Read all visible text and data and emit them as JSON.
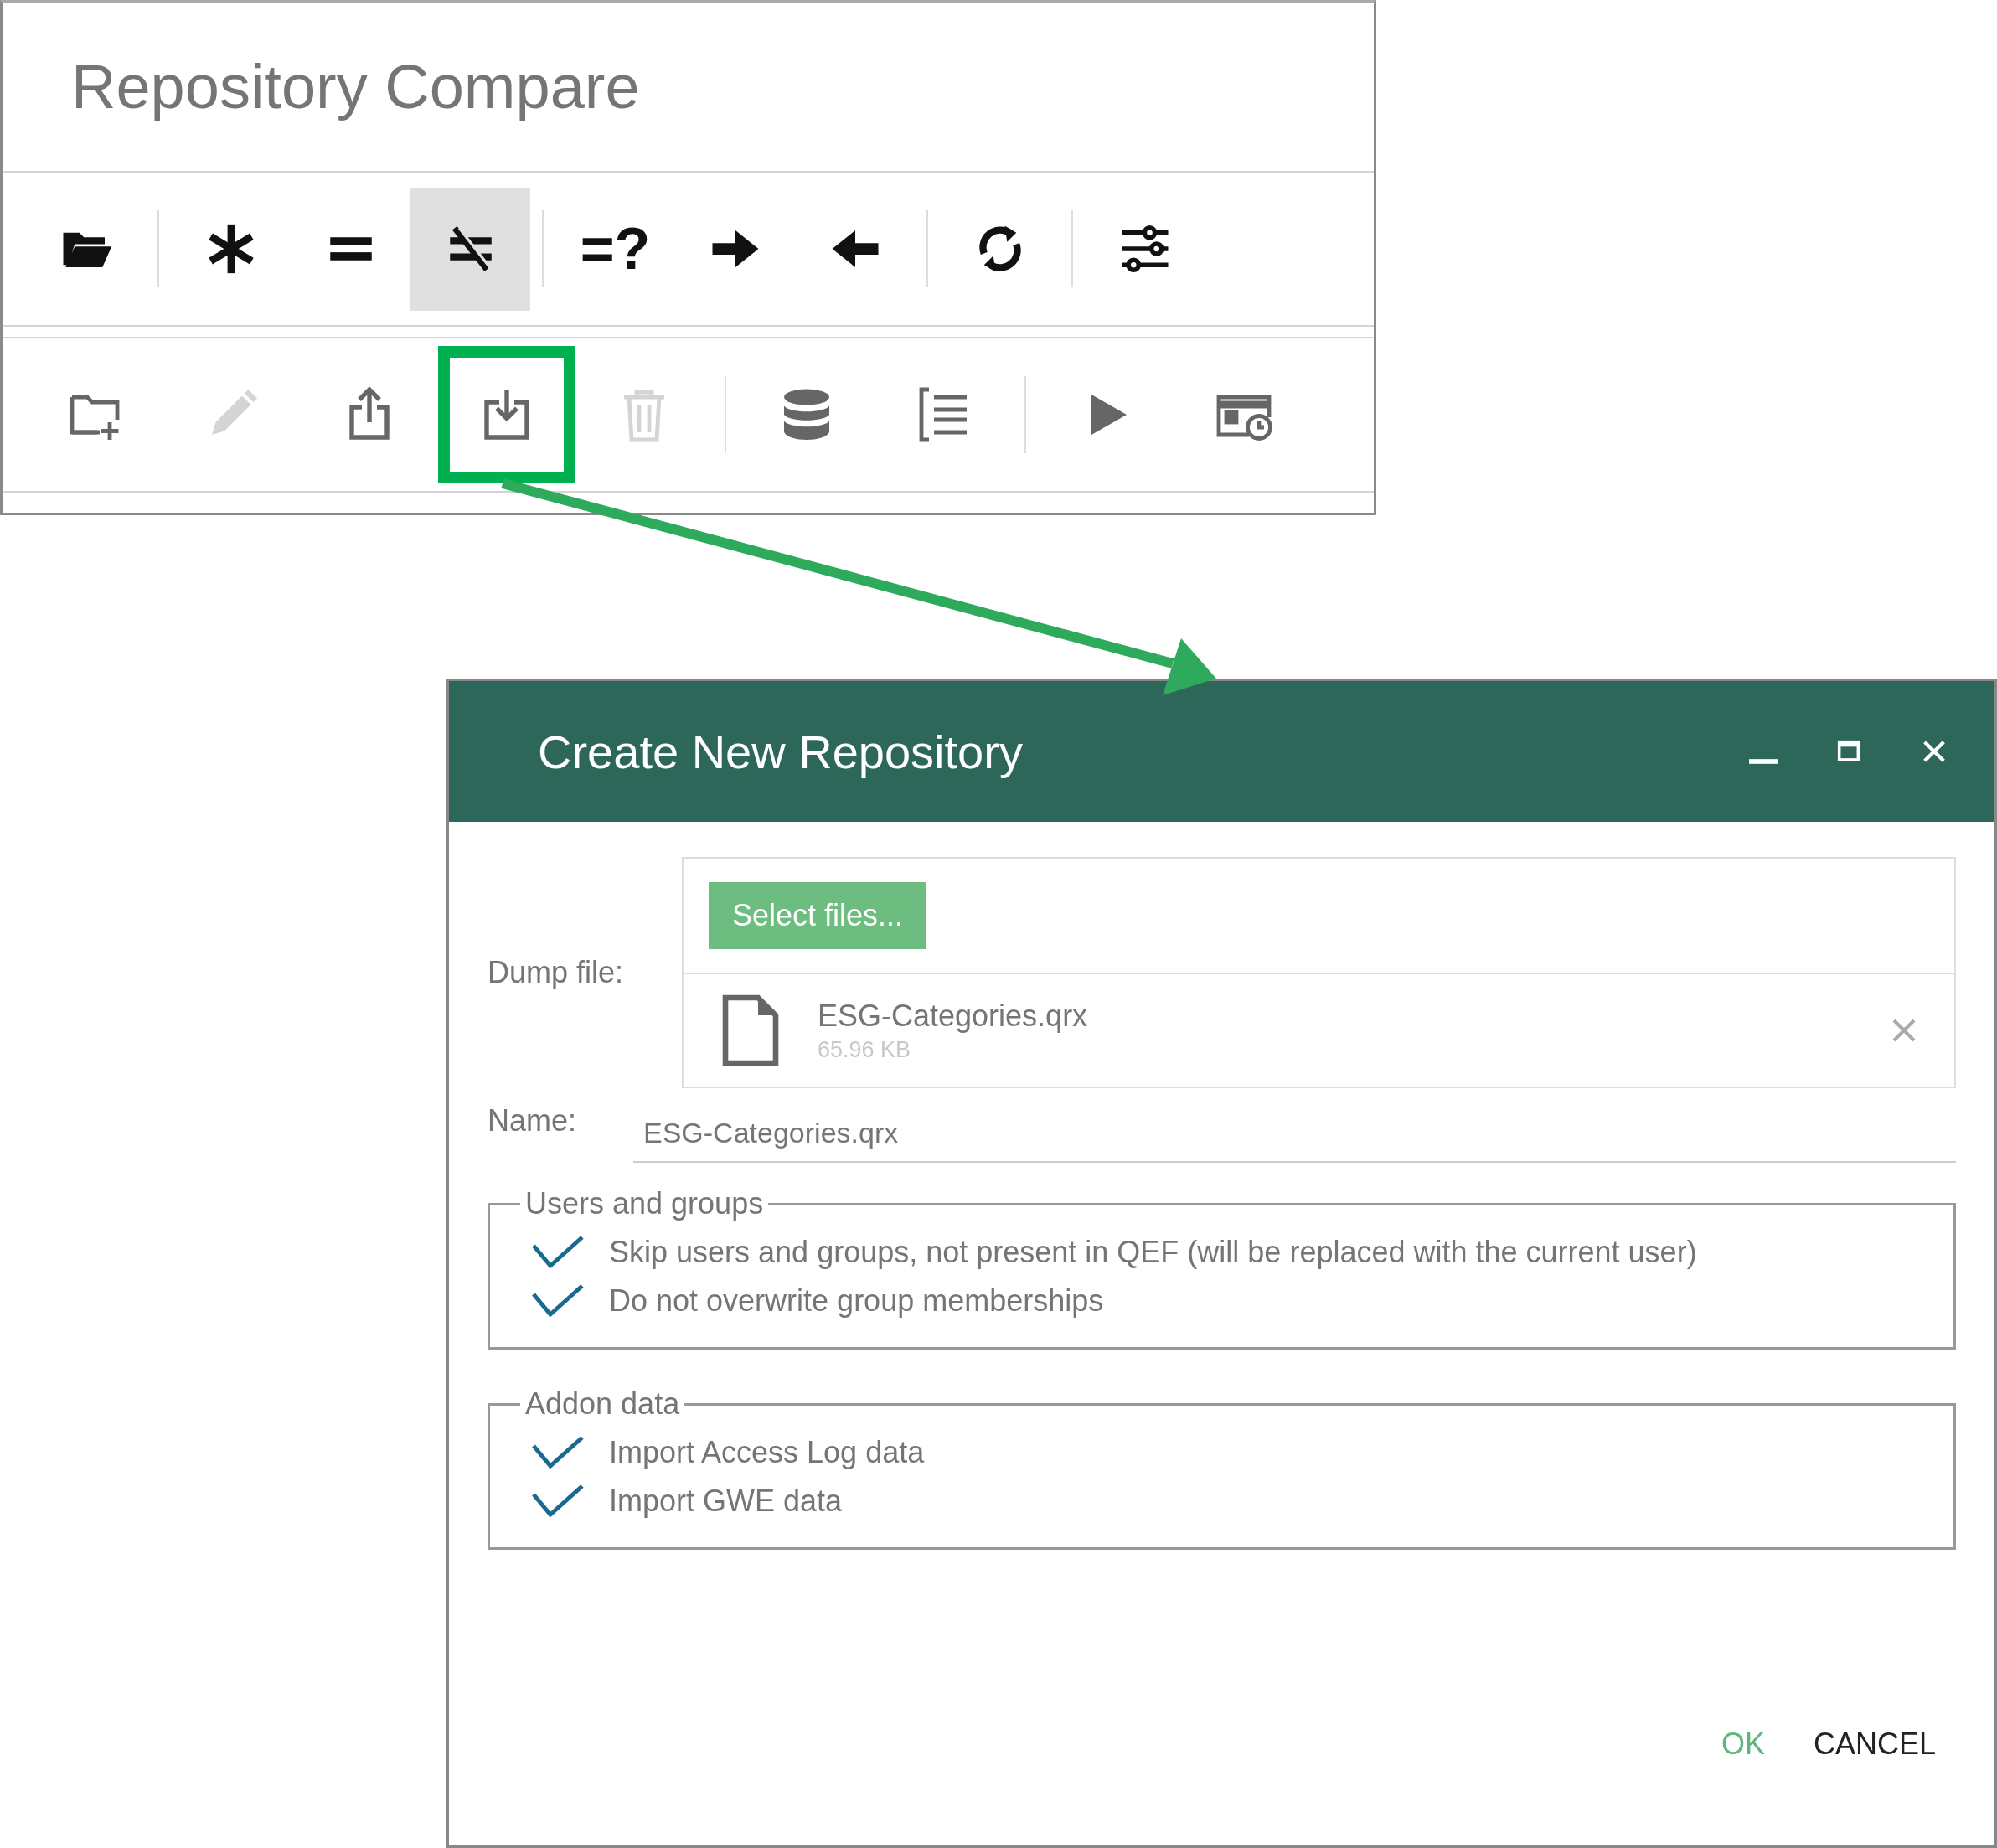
{
  "compare_panel": {
    "title": "Repository Compare",
    "toolbar_top": {
      "groups": [
        {
          "buttons": [
            {
              "selected": false
            }
          ]
        },
        {
          "buttons": [
            {
              "selected": false
            },
            {
              "selected": false
            },
            {
              "selected": true
            }
          ]
        },
        {
          "buttons": [
            {
              "selected": false,
              "label": "=?"
            },
            {
              "selected": false
            },
            {
              "selected": false
            }
          ]
        },
        {
          "buttons": [
            {
              "selected": false
            }
          ]
        },
        {
          "buttons": [
            {
              "selected": false
            }
          ]
        }
      ]
    },
    "toolbar_bottom": {
      "groups": [
        {
          "buttons": [
            {
              "disabled": false,
              "highlighted": false
            },
            {
              "disabled": true,
              "highlighted": false
            },
            {
              "disabled": false,
              "highlighted": false
            },
            {
              "disabled": false,
              "highlighted": true
            },
            {
              "disabled": true,
              "highlighted": false
            }
          ]
        },
        {
          "buttons": [
            {
              "disabled": false,
              "highlighted": false
            },
            {
              "disabled": false,
              "highlighted": false
            }
          ]
        },
        {
          "buttons": [
            {
              "disabled": false,
              "highlighted": false
            },
            {
              "disabled": false,
              "highlighted": false
            }
          ]
        }
      ]
    }
  },
  "dialog": {
    "title": "Create New Repository",
    "dump_file": {
      "label": "Dump file:",
      "button": "Select files...",
      "files": [
        {
          "name": "ESG-Categories.qrx",
          "size": "65.96 KB"
        }
      ]
    },
    "name": {
      "label": "Name:",
      "value": "ESG-Categories.qrx"
    },
    "sections": [
      {
        "legend": "Users and groups",
        "options": [
          {
            "label": "Skip users and groups, not present in QEF (will be replaced with the current user)",
            "checked": true
          },
          {
            "label": "Do not overwrite group memberships",
            "checked": true
          }
        ]
      },
      {
        "legend": "Addon data",
        "options": [
          {
            "label": "Import Access Log data",
            "checked": true
          },
          {
            "label": "Import GWE data",
            "checked": true
          }
        ]
      }
    ],
    "buttons": [
      {
        "label": "OK",
        "kind": "primary"
      },
      {
        "label": "CANCEL",
        "kind": "secondary"
      }
    ]
  }
}
